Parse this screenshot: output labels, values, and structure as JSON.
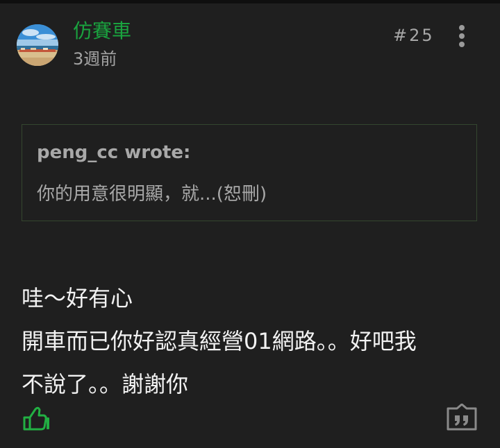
{
  "post": {
    "author": "仿賽車",
    "time": "3週前",
    "floor": "#25",
    "quote": {
      "author": "peng_cc wrote:",
      "text": "你的用意很明顯，就...(恕刪)"
    },
    "body_lines": [
      "哇～好有心",
      "開車而已你好認真經營01網路。。好吧我",
      "不說了。。謝謝你"
    ]
  },
  "icons": {
    "avatar": "avatar-beach-photo",
    "more": "more-vertical-icon",
    "like": "thumbs-up-icon",
    "reply_quote": "quote-reply-icon"
  },
  "colors": {
    "background": "#1f1f1f",
    "author": "#1aa33f",
    "like_icon": "#22b043",
    "quote_border": "#34462f",
    "secondary_text": "#a8a8a8",
    "body_text": "#f2f2f2"
  }
}
